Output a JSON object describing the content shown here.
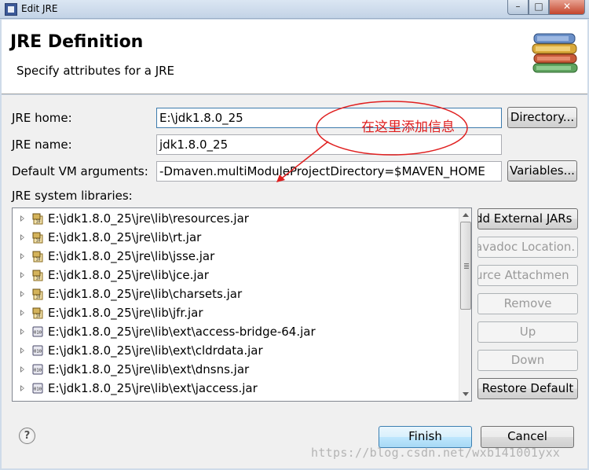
{
  "window": {
    "title": "Edit JRE",
    "controls": {
      "minimize": "–",
      "maximize": "□",
      "close": "✕"
    }
  },
  "header": {
    "title": "JRE Definition",
    "subtitle": "Specify attributes for a JRE",
    "icon": "books-icon"
  },
  "form": {
    "jre_home_label": "JRE home:",
    "jre_home_value": "E:\\jdk1.8.0_25",
    "directory_button": "Directory...",
    "jre_name_label": "JRE name:",
    "jre_name_value": "jdk1.8.0_25",
    "vm_args_label": "Default VM arguments:",
    "vm_args_value": "-Dmaven.multiModuleProjectDirectory=$MAVEN_HOME",
    "variables_button": "Variables...",
    "libraries_label": "JRE system libraries:"
  },
  "libraries": [
    {
      "path": "E:\\jdk1.8.0_25\\jre\\lib\\resources.jar",
      "icon": "jar-icon"
    },
    {
      "path": "E:\\jdk1.8.0_25\\jre\\lib\\rt.jar",
      "icon": "jar-icon"
    },
    {
      "path": "E:\\jdk1.8.0_25\\jre\\lib\\jsse.jar",
      "icon": "jar-icon"
    },
    {
      "path": "E:\\jdk1.8.0_25\\jre\\lib\\jce.jar",
      "icon": "jar-icon"
    },
    {
      "path": "E:\\jdk1.8.0_25\\jre\\lib\\charsets.jar",
      "icon": "jar-icon"
    },
    {
      "path": "E:\\jdk1.8.0_25\\jre\\lib\\jfr.jar",
      "icon": "jar-icon"
    },
    {
      "path": "E:\\jdk1.8.0_25\\jre\\lib\\ext\\access-bridge-64.jar",
      "icon": "binary-jar-icon"
    },
    {
      "path": "E:\\jdk1.8.0_25\\jre\\lib\\ext\\cldrdata.jar",
      "icon": "binary-jar-icon"
    },
    {
      "path": "E:\\jdk1.8.0_25\\jre\\lib\\ext\\dnsns.jar",
      "icon": "binary-jar-icon"
    },
    {
      "path": "E:\\jdk1.8.0_25\\jre\\lib\\ext\\jaccess.jar",
      "icon": "binary-jar-icon"
    }
  ],
  "library_buttons": {
    "add_external": "dd External JARs",
    "javadoc": "avadoc Location.",
    "source": "urce Attachmen",
    "remove": "Remove",
    "up": "Up",
    "down": "Down",
    "restore": "Restore Default"
  },
  "footer": {
    "finish": "Finish",
    "cancel": "Cancel"
  },
  "annotation": {
    "text": "在这里添加信息",
    "color": "#e02020"
  },
  "watermark": "https://blog.csdn.net/wxb141001yxx"
}
